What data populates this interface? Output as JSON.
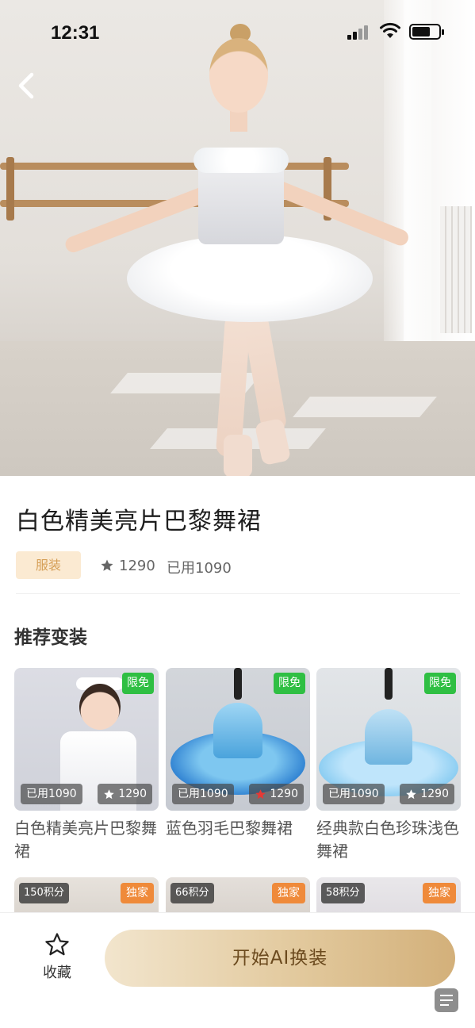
{
  "status_bar": {
    "time": "12:31"
  },
  "product": {
    "title": "白色精美亮片巴黎舞裙",
    "tag": "服装",
    "stars": "1290",
    "used": "已用1090"
  },
  "section": {
    "title": "推荐变装"
  },
  "recommendations": [
    {
      "label": "白色精美亮片巴黎舞裙",
      "badge": "限免",
      "used": "已用1090",
      "stars": "1290",
      "star_color": "#ffffff"
    },
    {
      "label": "蓝色羽毛巴黎舞裙",
      "badge": "限免",
      "used": "已用1090",
      "stars": "1290",
      "star_color": "#e53935"
    },
    {
      "label": "经典款白色珍珠浅色舞裙",
      "badge": "限免",
      "used": "已用1090",
      "stars": "1290",
      "star_color": "#ffffff"
    }
  ],
  "more_items": [
    {
      "points": "150积分",
      "badge": "独家"
    },
    {
      "points": "66积分",
      "badge": "独家"
    },
    {
      "points": "58积分",
      "badge": "独家"
    }
  ],
  "bottom": {
    "favorite_label": "收藏",
    "cta_label": "开始AI换装"
  },
  "icons": {
    "back": "chevron-left-icon",
    "favorite": "star-outline-icon",
    "rating": "star-icon",
    "doc": "document-icon"
  },
  "colors": {
    "tag_bg": "#fbead2",
    "tag_text": "#d69f56",
    "free_badge": "#2fbf43",
    "exclusive_badge": "#ef8a3a",
    "cta_gradient_start": "#f2e5cd",
    "cta_gradient_end": "#d3b07a"
  }
}
